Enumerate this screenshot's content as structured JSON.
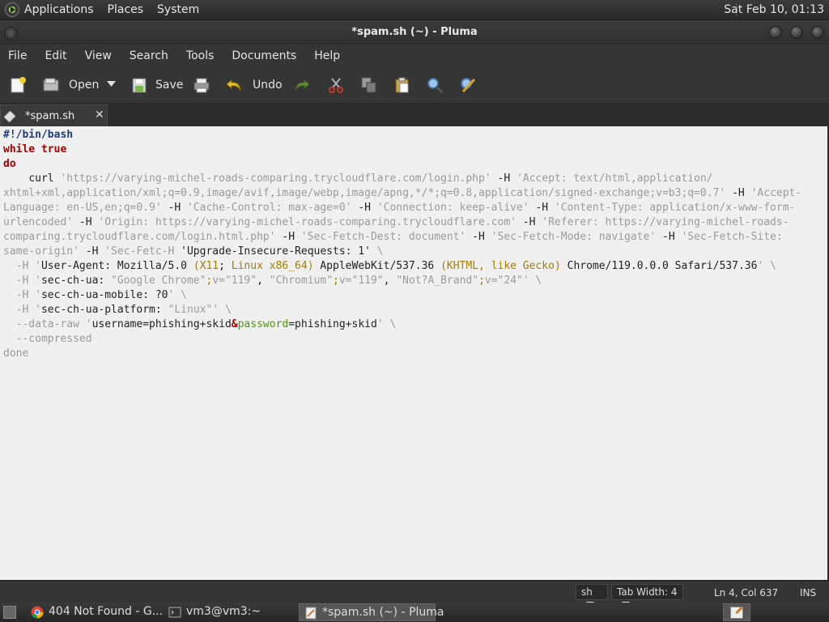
{
  "top_panel": {
    "menus": [
      "Applications",
      "Places",
      "System"
    ],
    "clock": "Sat Feb 10, 01:13"
  },
  "window": {
    "title": "*spam.sh (~) - Pluma"
  },
  "menubar": [
    "File",
    "Edit",
    "View",
    "Search",
    "Tools",
    "Documents",
    "Help"
  ],
  "toolbar": {
    "open_label": "Open",
    "save_label": "Save",
    "undo_label": "Undo"
  },
  "tab": {
    "label": "*spam.sh",
    "close": "✕"
  },
  "code": {
    "l1": "#!/bin/bash",
    "l2": "while true",
    "l3": "do",
    "l4_cmd": "curl",
    "l4_url": "'https://varying-michel-roads-comparing.trycloudflare.com/login.php'",
    "h": "-H",
    "accept_a": "'Accept: text/html,application/",
    "accept_b": "xhtml+xml,application/xml;q=0.9,image/avif,image/webp,image/apng,*/*;q=0.8,application/signed-exchange;v=b3;q=0.7'",
    "lang_a": "'Accept-",
    "lang_b": "Language: en-US,en;q=0.9'",
    "cache": "'Cache-Control: max-age=0'",
    "conn": "'Connection: keep-alive'",
    "ctype_a": "'Content-Type: application/x-www-form-",
    "ctype_b": "urlencoded'",
    "origin": "'Origin: https://varying-michel-roads-comparing.trycloudflare.com'",
    "ref_a": "'Referer: https://varying-michel-roads-",
    "ref_b": "comparing.trycloudflare.com/login.html.php'",
    "fdest": "'Sec-Fetch-Dest: document'",
    "fmode": "'Sec-Fetch-Mode: navigate'",
    "fsite_a": "'Sec-Fetch-Site:",
    "fsite_b": "same-origin'",
    "fetc": "'Sec-Fetc-H",
    "upg": "'Upgrade-Insecure-Requests: 1'",
    "bs": "\\",
    "ua_q": "'",
    "ua_a": "User-Agent: Mozilla/5.0 ",
    "ua_p1": "(",
    "ua_x11": "X11",
    "ua_semi": ";",
    "ua_linux": " Linux x86_64",
    "ua_p2": ")",
    "ua_b": " AppleWebKit/537.36 ",
    "ua_p3": "(",
    "ua_khtml": "KHTML, like Gecko",
    "ua_p4": ")",
    "ua_c": " Chrome/119.0.0.0 Safari/537.36",
    "ua_end": "'",
    "chua_a": "sec-ch-ua: ",
    "chua_gc": "\"Google Chrome\"",
    "semi": ";",
    "v119": "v=\"119\"",
    "comma": ", ",
    "chua_cr": "\"Chromium\"",
    "chua_na": "\"Not?A_Brand\"",
    "v24": "v=\"24\"",
    "chua_end": "'",
    "mob_a": "sec-ch-ua-mobile: ?0",
    "plat_a": "sec-ch-ua-platform: ",
    "plat_b": "\"Linux\"'",
    "dr": "--data-raw",
    "dr_q": "'",
    "dr_a": "username=phishing+skid",
    "amp": "&",
    "pw": "password",
    "dr_b": "=phishing+skid",
    "comp": "--compressed",
    "done": "done"
  },
  "statusbar": {
    "lang": "sh",
    "tabwidth": "Tab Width:  4",
    "position": "Ln 4, Col 637",
    "mode": "INS"
  },
  "taskbar": {
    "tasks": [
      "404 Not Found - G...",
      "vm3@vm3:~",
      "*spam.sh (~) - Pluma"
    ]
  }
}
